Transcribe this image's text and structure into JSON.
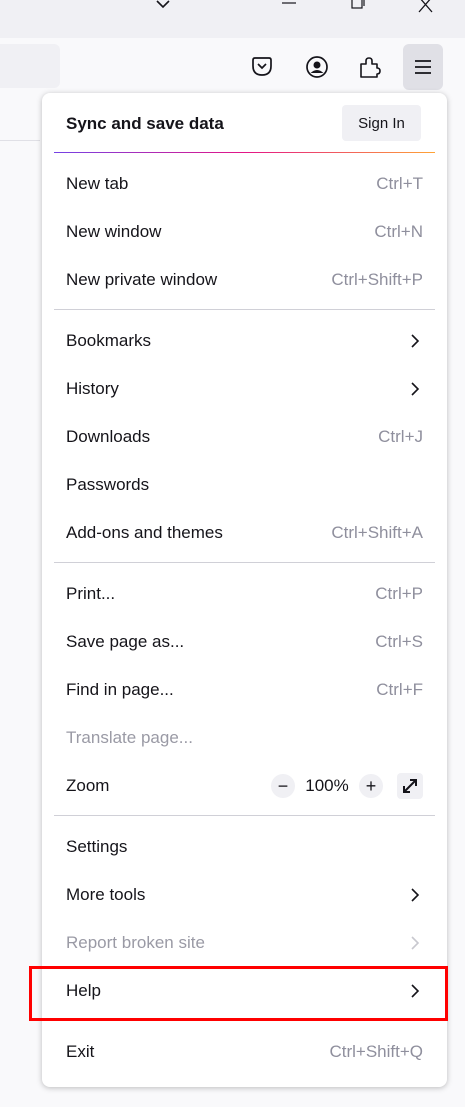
{
  "titlebar": {
    "chevron_icon": "chevron-down-icon",
    "minimize_icon": "minimize-icon",
    "restore_icon": "restore-icon",
    "close_icon": "close-icon"
  },
  "toolbar": {
    "icons": [
      "pocket-icon",
      "account-icon",
      "extensions-icon",
      "app-menu-icon"
    ]
  },
  "menu": {
    "sync_title": "Sync and save data",
    "sign_in": "Sign In",
    "items": [
      {
        "label": "New tab",
        "shortcut": "Ctrl+T"
      },
      {
        "label": "New window",
        "shortcut": "Ctrl+N"
      },
      {
        "label": "New private window",
        "shortcut": "Ctrl+Shift+P"
      },
      {
        "label": "Bookmarks",
        "submenu": true
      },
      {
        "label": "History",
        "submenu": true
      },
      {
        "label": "Downloads",
        "shortcut": "Ctrl+J"
      },
      {
        "label": "Passwords"
      },
      {
        "label": "Add-ons and themes",
        "shortcut": "Ctrl+Shift+A"
      },
      {
        "label": "Print...",
        "shortcut": "Ctrl+P"
      },
      {
        "label": "Save page as...",
        "shortcut": "Ctrl+S"
      },
      {
        "label": "Find in page...",
        "shortcut": "Ctrl+F"
      },
      {
        "label": "Translate page...",
        "disabled": true
      },
      {
        "label": "Zoom"
      },
      {
        "label": "Settings"
      },
      {
        "label": "More tools",
        "submenu": true
      },
      {
        "label": "Report broken site",
        "submenu": true,
        "disabled": true
      },
      {
        "label": "Help",
        "submenu": true
      },
      {
        "label": "Exit",
        "shortcut": "Ctrl+Shift+Q"
      }
    ],
    "zoom": {
      "minus": "−",
      "value": "100%",
      "plus": "+"
    }
  },
  "colors": {
    "highlight": "#ff0000",
    "panel_bg": "#ffffff",
    "shortcut": "#8f8f9d"
  }
}
